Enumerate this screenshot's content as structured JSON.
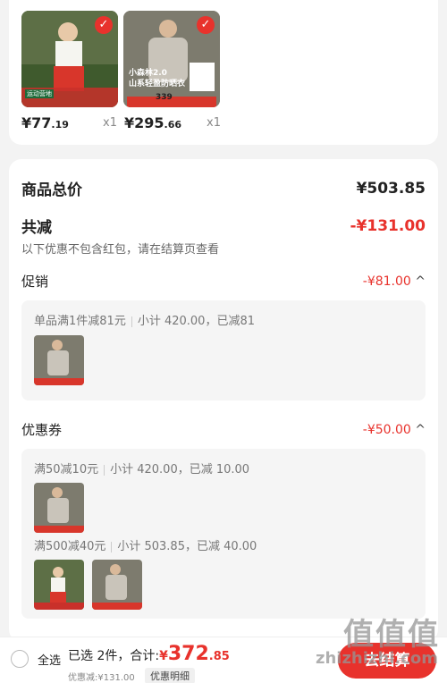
{
  "products": [
    {
      "price_int": "¥77",
      "price_dec": ".19",
      "qty": "x1",
      "badge": "运动营地"
    },
    {
      "price_int": "¥295",
      "price_dec": ".66",
      "qty": "x1",
      "caption_1": "小森林2.0",
      "caption_2": "山系轻盈防晒衣",
      "badge_price": "339"
    }
  ],
  "summary": {
    "total_label": "商品总价",
    "total_value": "¥503.85",
    "reduce_label": "共减",
    "reduce_value": "-¥131.00",
    "reduce_note": "以下优惠不包含红包，请在结算页查看"
  },
  "promo": {
    "label": "促销",
    "value": "-¥81.00",
    "chevron": "^",
    "rule": "单品满1件减81元",
    "detail": "小计 420.00，已减81"
  },
  "coupon": {
    "label": "优惠券",
    "value": "-¥50.00",
    "chevron": "^",
    "rule1": "满50减10元",
    "detail1": "小计 420.00，已减 10.00",
    "rule2": "满500减40元",
    "detail2": "小计 503.85，已减 40.00"
  },
  "footer": {
    "select_all": "全选",
    "selected": "已选 2件，合计:",
    "yen": "¥",
    "total_int": "372",
    "total_dec": ".85",
    "discount": "优惠减:¥131.00",
    "detail_btn": "优惠明细",
    "checkout": "去结算"
  },
  "watermark": {
    "line1": "值值值",
    "line2": "zhizhizhi.com"
  },
  "colors": {
    "accent": "#e8322c"
  }
}
